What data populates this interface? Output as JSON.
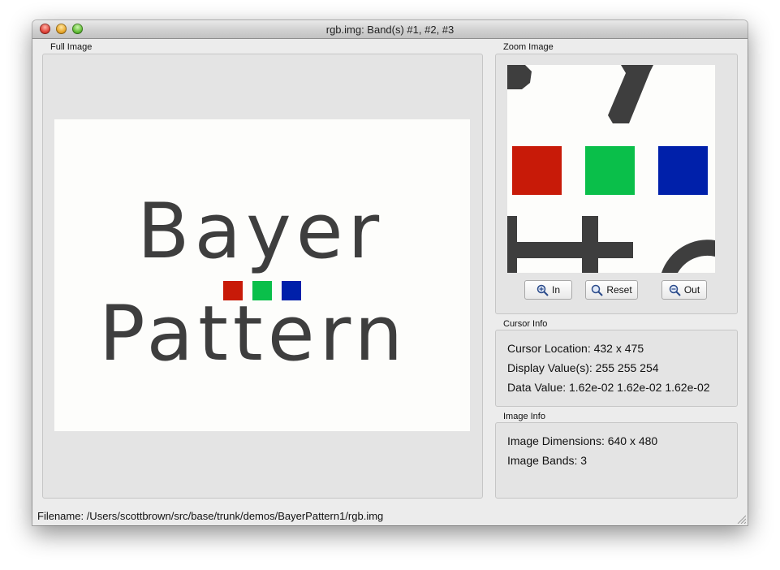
{
  "window": {
    "title": "rgb.img:  Band(s) #1, #2, #3"
  },
  "full_image": {
    "label": "Full Image",
    "text_line1": "Bayer",
    "text_line2": "Pattern",
    "squares": [
      "#c81a08",
      "#0abf4a",
      "#0020aa"
    ]
  },
  "zoom_image": {
    "label": "Zoom Image",
    "buttons": {
      "zoom_in": "In",
      "reset": "Reset",
      "zoom_out": "Out"
    },
    "icons": [
      "zoom-in-icon",
      "magnifier-icon",
      "zoom-out-icon"
    ]
  },
  "cursor_info": {
    "label": "Cursor Info",
    "location": "Cursor Location: 432 x 475",
    "display_values": "Display Value(s): 255 255 254",
    "data_value": "Data Value: 1.62e-02 1.62e-02 1.62e-02"
  },
  "image_info": {
    "label": "Image Info",
    "dimensions": "Image Dimensions: 640 x 480",
    "bands": "Image Bands: 3"
  },
  "status": {
    "filename": "Filename:  /Users/scottbrown/src/base/trunk/demos/BayerPattern1/rgb.img"
  },
  "colors": {
    "red": "#c81a08",
    "green": "#0abf4a",
    "blue": "#0020aa",
    "text_gray": "#3e3e3e"
  }
}
